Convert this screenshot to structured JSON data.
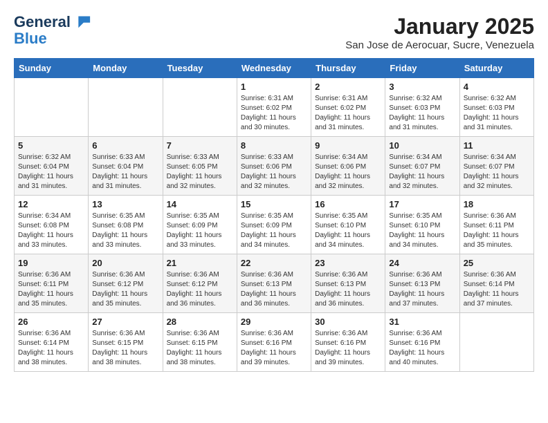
{
  "logo": {
    "line1": "General",
    "line2": "Blue"
  },
  "title": "January 2025",
  "subtitle": "San Jose de Aerocuar, Sucre, Venezuela",
  "weekdays": [
    "Sunday",
    "Monday",
    "Tuesday",
    "Wednesday",
    "Thursday",
    "Friday",
    "Saturday"
  ],
  "weeks": [
    [
      {
        "day": "",
        "info": ""
      },
      {
        "day": "",
        "info": ""
      },
      {
        "day": "",
        "info": ""
      },
      {
        "day": "1",
        "info": "Sunrise: 6:31 AM\nSunset: 6:02 PM\nDaylight: 11 hours and 30 minutes."
      },
      {
        "day": "2",
        "info": "Sunrise: 6:31 AM\nSunset: 6:02 PM\nDaylight: 11 hours and 31 minutes."
      },
      {
        "day": "3",
        "info": "Sunrise: 6:32 AM\nSunset: 6:03 PM\nDaylight: 11 hours and 31 minutes."
      },
      {
        "day": "4",
        "info": "Sunrise: 6:32 AM\nSunset: 6:03 PM\nDaylight: 11 hours and 31 minutes."
      }
    ],
    [
      {
        "day": "5",
        "info": "Sunrise: 6:32 AM\nSunset: 6:04 PM\nDaylight: 11 hours and 31 minutes."
      },
      {
        "day": "6",
        "info": "Sunrise: 6:33 AM\nSunset: 6:04 PM\nDaylight: 11 hours and 31 minutes."
      },
      {
        "day": "7",
        "info": "Sunrise: 6:33 AM\nSunset: 6:05 PM\nDaylight: 11 hours and 32 minutes."
      },
      {
        "day": "8",
        "info": "Sunrise: 6:33 AM\nSunset: 6:06 PM\nDaylight: 11 hours and 32 minutes."
      },
      {
        "day": "9",
        "info": "Sunrise: 6:34 AM\nSunset: 6:06 PM\nDaylight: 11 hours and 32 minutes."
      },
      {
        "day": "10",
        "info": "Sunrise: 6:34 AM\nSunset: 6:07 PM\nDaylight: 11 hours and 32 minutes."
      },
      {
        "day": "11",
        "info": "Sunrise: 6:34 AM\nSunset: 6:07 PM\nDaylight: 11 hours and 32 minutes."
      }
    ],
    [
      {
        "day": "12",
        "info": "Sunrise: 6:34 AM\nSunset: 6:08 PM\nDaylight: 11 hours and 33 minutes."
      },
      {
        "day": "13",
        "info": "Sunrise: 6:35 AM\nSunset: 6:08 PM\nDaylight: 11 hours and 33 minutes."
      },
      {
        "day": "14",
        "info": "Sunrise: 6:35 AM\nSunset: 6:09 PM\nDaylight: 11 hours and 33 minutes."
      },
      {
        "day": "15",
        "info": "Sunrise: 6:35 AM\nSunset: 6:09 PM\nDaylight: 11 hours and 34 minutes."
      },
      {
        "day": "16",
        "info": "Sunrise: 6:35 AM\nSunset: 6:10 PM\nDaylight: 11 hours and 34 minutes."
      },
      {
        "day": "17",
        "info": "Sunrise: 6:35 AM\nSunset: 6:10 PM\nDaylight: 11 hours and 34 minutes."
      },
      {
        "day": "18",
        "info": "Sunrise: 6:36 AM\nSunset: 6:11 PM\nDaylight: 11 hours and 35 minutes."
      }
    ],
    [
      {
        "day": "19",
        "info": "Sunrise: 6:36 AM\nSunset: 6:11 PM\nDaylight: 11 hours and 35 minutes."
      },
      {
        "day": "20",
        "info": "Sunrise: 6:36 AM\nSunset: 6:12 PM\nDaylight: 11 hours and 35 minutes."
      },
      {
        "day": "21",
        "info": "Sunrise: 6:36 AM\nSunset: 6:12 PM\nDaylight: 11 hours and 36 minutes."
      },
      {
        "day": "22",
        "info": "Sunrise: 6:36 AM\nSunset: 6:13 PM\nDaylight: 11 hours and 36 minutes."
      },
      {
        "day": "23",
        "info": "Sunrise: 6:36 AM\nSunset: 6:13 PM\nDaylight: 11 hours and 36 minutes."
      },
      {
        "day": "24",
        "info": "Sunrise: 6:36 AM\nSunset: 6:13 PM\nDaylight: 11 hours and 37 minutes."
      },
      {
        "day": "25",
        "info": "Sunrise: 6:36 AM\nSunset: 6:14 PM\nDaylight: 11 hours and 37 minutes."
      }
    ],
    [
      {
        "day": "26",
        "info": "Sunrise: 6:36 AM\nSunset: 6:14 PM\nDaylight: 11 hours and 38 minutes."
      },
      {
        "day": "27",
        "info": "Sunrise: 6:36 AM\nSunset: 6:15 PM\nDaylight: 11 hours and 38 minutes."
      },
      {
        "day": "28",
        "info": "Sunrise: 6:36 AM\nSunset: 6:15 PM\nDaylight: 11 hours and 38 minutes."
      },
      {
        "day": "29",
        "info": "Sunrise: 6:36 AM\nSunset: 6:16 PM\nDaylight: 11 hours and 39 minutes."
      },
      {
        "day": "30",
        "info": "Sunrise: 6:36 AM\nSunset: 6:16 PM\nDaylight: 11 hours and 39 minutes."
      },
      {
        "day": "31",
        "info": "Sunrise: 6:36 AM\nSunset: 6:16 PM\nDaylight: 11 hours and 40 minutes."
      },
      {
        "day": "",
        "info": ""
      }
    ]
  ]
}
